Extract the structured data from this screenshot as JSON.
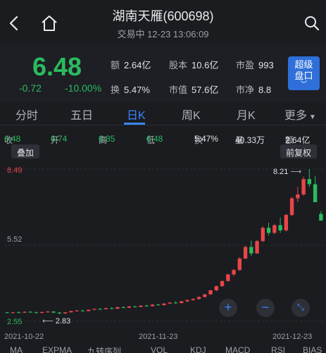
{
  "header": {
    "title": "湖南天雁(600698)",
    "subtitle": "交易中 12-23 13:06:09"
  },
  "quote": {
    "price": "6.48",
    "change": "-0.72",
    "change_pct": "-10.00%",
    "stats": [
      {
        "label": "额",
        "value": "2.64亿"
      },
      {
        "label": "股本",
        "value": "10.6亿"
      },
      {
        "label": "市盈",
        "value": "993"
      },
      {
        "label": "换",
        "value": "5.47%"
      },
      {
        "label": "市值",
        "value": "57.6亿"
      },
      {
        "label": "市净",
        "value": "8.8"
      }
    ],
    "super_button": {
      "line1": "超级",
      "line2": "盘口",
      "chevron": "﹀"
    }
  },
  "tabs": [
    "分时",
    "五日",
    "日K",
    "周K",
    "月K",
    "更多"
  ],
  "active_tab": "日K",
  "ohlc": {
    "close_label": "收",
    "close": "6.48",
    "open_label": "开",
    "open": "6.74",
    "high_label": "高",
    "high": "6.85",
    "low_label": "低",
    "low": "6.48",
    "turnover_label": "换",
    "turnover": "5.47%",
    "volume_label": "量",
    "volume": "40.33万",
    "amount_label": "额",
    "amount": "2.64亿"
  },
  "overlay_button": "叠加",
  "adjust_button": "前复权",
  "chart_data": {
    "type": "candlestick",
    "y_labels": [
      "8.49",
      "5.52",
      "2.55"
    ],
    "x_labels": [
      "2021-10-22",
      "2021-11-23",
      "2021-12-23"
    ],
    "annotations": {
      "max": "8.21",
      "min": "2.83"
    },
    "ylim": [
      2.55,
      8.49
    ],
    "candles": [
      [
        2.9,
        2.92,
        2.86,
        2.88
      ],
      [
        2.88,
        2.92,
        2.85,
        2.9
      ],
      [
        2.9,
        2.93,
        2.87,
        2.89
      ],
      [
        2.89,
        2.94,
        2.87,
        2.92
      ],
      [
        2.92,
        2.95,
        2.88,
        2.9
      ],
      [
        2.9,
        2.93,
        2.86,
        2.88
      ],
      [
        2.88,
        2.92,
        2.85,
        2.91
      ],
      [
        2.91,
        2.95,
        2.88,
        2.93
      ],
      [
        2.93,
        2.95,
        2.87,
        2.89
      ],
      [
        2.89,
        2.92,
        2.83,
        2.86
      ],
      [
        2.86,
        2.91,
        2.84,
        2.9
      ],
      [
        2.9,
        2.96,
        2.89,
        2.95
      ],
      [
        2.95,
        2.99,
        2.92,
        2.97
      ],
      [
        2.97,
        3.0,
        2.93,
        2.95
      ],
      [
        2.95,
        3.01,
        2.94,
        3.0
      ],
      [
        3.0,
        3.05,
        2.98,
        3.03
      ],
      [
        3.03,
        3.07,
        3.0,
        3.02
      ],
      [
        3.02,
        3.08,
        3.01,
        3.06
      ],
      [
        3.06,
        3.1,
        3.03,
        3.04
      ],
      [
        3.04,
        3.12,
        3.03,
        3.1
      ],
      [
        3.1,
        3.14,
        3.06,
        3.08
      ],
      [
        3.08,
        3.15,
        3.07,
        3.13
      ],
      [
        3.13,
        3.16,
        3.09,
        3.11
      ],
      [
        3.11,
        3.18,
        3.1,
        3.16
      ],
      [
        3.16,
        3.2,
        3.12,
        3.14
      ],
      [
        3.14,
        3.22,
        3.13,
        3.2
      ],
      [
        3.2,
        3.24,
        3.17,
        3.18
      ],
      [
        3.18,
        3.26,
        3.17,
        3.24
      ],
      [
        3.24,
        3.3,
        3.22,
        3.28
      ],
      [
        3.28,
        3.33,
        3.24,
        3.26
      ],
      [
        3.26,
        3.35,
        3.25,
        3.33
      ],
      [
        3.33,
        3.4,
        3.3,
        3.38
      ],
      [
        3.38,
        3.45,
        3.35,
        3.42
      ],
      [
        3.42,
        3.52,
        3.4,
        3.5
      ],
      [
        3.5,
        3.62,
        3.48,
        3.6
      ],
      [
        3.6,
        3.78,
        3.58,
        3.76
      ],
      [
        3.76,
        3.95,
        3.72,
        3.92
      ],
      [
        3.92,
        4.15,
        3.9,
        4.12
      ],
      [
        4.12,
        4.4,
        4.1,
        4.38
      ],
      [
        4.38,
        4.6,
        4.3,
        4.55
      ],
      [
        4.55,
        5.05,
        4.52,
        5.0
      ],
      [
        5.0,
        5.5,
        4.98,
        5.45
      ],
      [
        5.45,
        5.7,
        5.1,
        5.2
      ],
      [
        5.2,
        5.72,
        5.18,
        5.68
      ],
      [
        5.68,
        6.25,
        5.65,
        6.2
      ],
      [
        6.2,
        6.4,
        5.9,
        6.0
      ],
      [
        6.0,
        6.35,
        5.95,
        6.3
      ],
      [
        6.3,
        6.6,
        6.0,
        6.1
      ],
      [
        6.1,
        6.75,
        6.05,
        6.7
      ],
      [
        6.7,
        7.4,
        6.65,
        7.35
      ],
      [
        7.35,
        7.8,
        7.2,
        7.5
      ],
      [
        7.5,
        8.2,
        7.45,
        8.1
      ],
      [
        8.1,
        8.49,
        7.8,
        7.9
      ],
      [
        7.9,
        8.21,
        7.2,
        7.2
      ],
      [
        6.74,
        6.85,
        6.48,
        6.48
      ]
    ]
  },
  "indicators": [
    "MA",
    "EXPMA",
    "九转序列",
    "VOL",
    "KDJ",
    "MACD",
    "RSI",
    "BIAS"
  ]
}
